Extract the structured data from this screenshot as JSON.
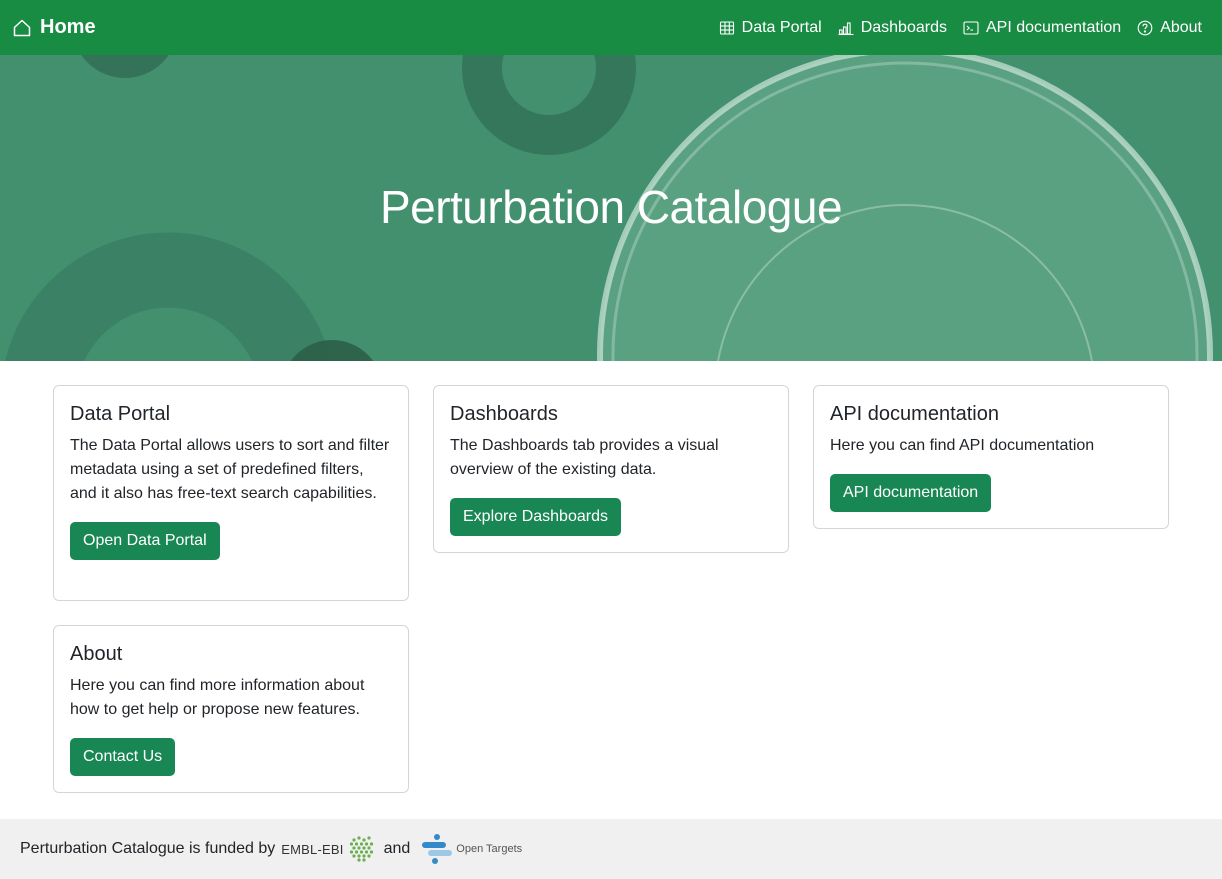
{
  "navbar": {
    "brand_label": "Home",
    "links": [
      {
        "label": "Data Portal",
        "icon": "table-icon"
      },
      {
        "label": "Dashboards",
        "icon": "bar-chart-icon"
      },
      {
        "label": "API documentation",
        "icon": "terminal-icon"
      },
      {
        "label": "About",
        "icon": "question-circle-icon"
      }
    ]
  },
  "hero": {
    "title": "Perturbation Catalogue"
  },
  "cards": [
    {
      "title": "Data Portal",
      "text": "The Data Portal allows users to sort and filter metadata using a set of predefined filters, and it also has free-text search capabilities.",
      "button": "Open Data Portal"
    },
    {
      "title": "Dashboards",
      "text": "The Dashboards tab provides a visual overview of the existing data.",
      "button": "Explore Dashboards"
    },
    {
      "title": "API documentation",
      "text": "Here you can find API documentation",
      "button": "API documentation"
    },
    {
      "title": "About",
      "text": "Here you can find more information about how to get help or propose new features.",
      "button": "Contact Us"
    }
  ],
  "footer": {
    "funded_text": "Perturbation Catalogue is funded by",
    "ebi_label": "EMBL-EBI",
    "and_text": "and",
    "ot_label": "Open Targets"
  },
  "colors": {
    "navbar": "#198c44",
    "hero": "#42906e",
    "button": "#198754",
    "footer": "#f0f0f0"
  }
}
